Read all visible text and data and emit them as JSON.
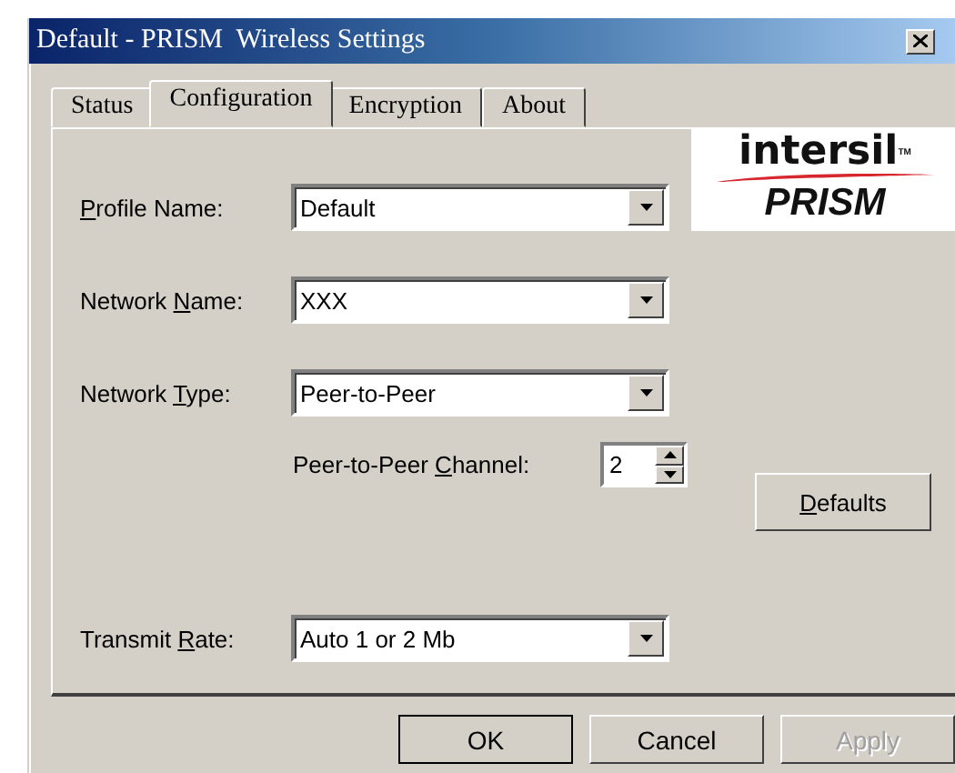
{
  "window": {
    "title": "Default - PRISM  Wireless Settings"
  },
  "tabs": [
    {
      "label": "Status",
      "selected": false
    },
    {
      "label": "Configuration",
      "selected": true
    },
    {
      "label": "Encryption",
      "selected": false
    },
    {
      "label": "About",
      "selected": false
    }
  ],
  "logo": {
    "brand": "intersil",
    "trademark": "TM",
    "product": "PRISM"
  },
  "fields": [
    {
      "kind": "combo",
      "access_key": "P",
      "label_after": "rofile Name:",
      "value": "Default"
    },
    {
      "kind": "combo",
      "label_before": "Network ",
      "access_key": "N",
      "label_after": "ame:",
      "value": "XXX"
    },
    {
      "kind": "combo",
      "label_before": "Network ",
      "access_key": "T",
      "label_after": "ype:",
      "value": "Peer-to-Peer"
    },
    {
      "kind": "spin",
      "label_before": "Peer-to-Peer ",
      "access_key": "C",
      "label_after": "hannel:",
      "value": "2"
    },
    {
      "kind": "combo",
      "label_before": "Transmit ",
      "access_key": "R",
      "label_after": "ate:",
      "value": "Auto 1 or 2 Mb"
    }
  ],
  "defaults_button": {
    "access_key": "D",
    "label_after": "efaults"
  },
  "buttons": [
    {
      "label": "OK",
      "default": true,
      "disabled": false
    },
    {
      "label": "Cancel",
      "default": false,
      "disabled": false
    },
    {
      "label": "Apply",
      "default": false,
      "disabled": true
    }
  ]
}
